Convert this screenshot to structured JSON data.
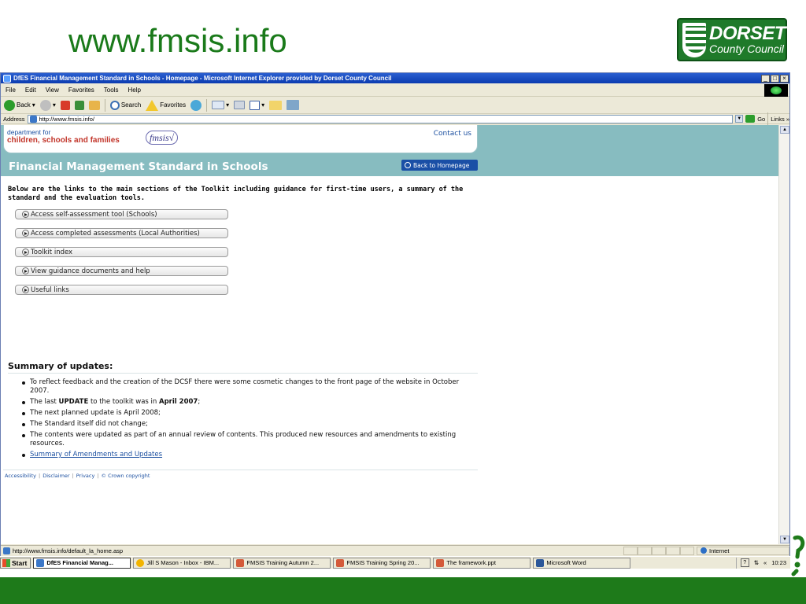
{
  "slide": {
    "title": "www.fmsis.info",
    "logo_line1": "DORSET",
    "logo_line2": "County Council"
  },
  "window": {
    "title": "DfES Financial Management Standard in Schools - Homepage - Microsoft Internet Explorer provided by Dorset County Council",
    "controls": [
      "_",
      "□",
      "×"
    ]
  },
  "menu": [
    "File",
    "Edit",
    "View",
    "Favorites",
    "Tools",
    "Help"
  ],
  "toolbar": {
    "back": "Back",
    "search": "Search",
    "favorites": "Favorites"
  },
  "address": {
    "label": "Address",
    "url": "http://www.fmsis.info/",
    "go": "Go",
    "links": "Links"
  },
  "site": {
    "dept_line1": "department for",
    "dept_line2": "children, schools and families",
    "fmsis_mark": "fmsis√",
    "contact": "Contact us",
    "band_title": "Financial Management Standard in Schools",
    "back_home": "Back to Homepage",
    "intro": "Below are the links to the main sections of the Toolkit including guidance for first-time users, a summary of the standard and the evaluation tools.",
    "nav": [
      "Access self-assessment tool (Schools)",
      "Access completed assessments (Local Authorities)",
      "Toolkit index",
      "View guidance documents and help",
      "Useful links"
    ],
    "summary_title": "Summary of updates:",
    "updates": {
      "u1": "To reflect feedback and the creation of the DCSF there were some cosmetic changes to the front page of the website in October 2007.",
      "u2_a": "The last ",
      "u2_b": "UPDATE",
      "u2_c": " to the toolkit was in ",
      "u2_d": "April 2007",
      "u2_e": ";",
      "u3": "The next planned update is April 2008;",
      "u4": "The Standard itself did not change;",
      "u5": "The contents were updated as part of an annual review of contents. This produced new resources and amendments to existing resources.",
      "u6": "Summary of Amendments and Updates"
    },
    "footer_links": [
      "Accessibility",
      "Disclaimer",
      "Privacy",
      "© Crown copyright"
    ]
  },
  "status": {
    "url": "http://www.fmsis.info/default_la_home.asp",
    "zone": "Internet"
  },
  "taskbar": {
    "start": "Start",
    "tasks": [
      "DfES Financial Manag...",
      "Jill S Mason - Inbox - IBM...",
      "FMSIS Training Autumn 2...",
      "FMSIS Training Spring 20...",
      "The framework.ppt",
      "Microsoft Word"
    ],
    "clock": "10:23"
  },
  "colors": {
    "slide_green": "#1e7a1a",
    "teal_band": "#87bcc0",
    "link_blue": "#1b4fa0"
  }
}
